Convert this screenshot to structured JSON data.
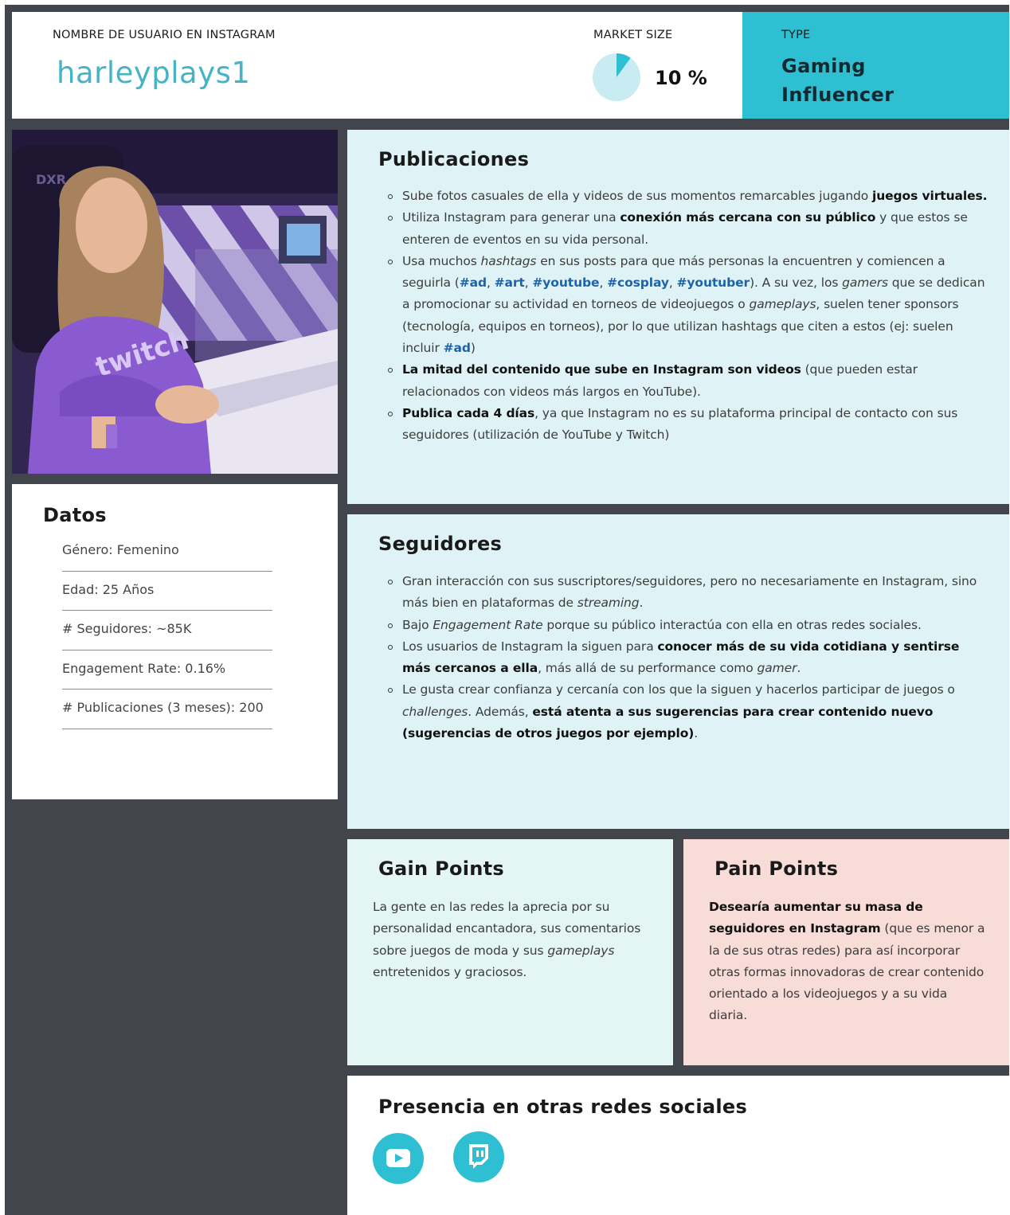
{
  "header": {
    "username_label": "NOMBRE DE USUARIO EN INSTAGRAM",
    "username": "harleyplays1",
    "market_size_label": "MARKET SIZE",
    "market_size_value": "10 %",
    "market_size_fraction": 0.1,
    "type_label": "TYPE",
    "type_line1": "Gaming",
    "type_line2": "Influencer"
  },
  "colors": {
    "background": "#42464c",
    "accent_teal": "#2ebfd3",
    "username_color": "#45b4c4",
    "publicaciones_bg": "#dff3f6",
    "gain_bg": "#e3f6f3",
    "pain_bg": "#f8dcd8",
    "hashtag_color": "#1e63a8"
  },
  "photo": {
    "icon": "profile-photo"
  },
  "datos": {
    "title": "Datos",
    "rows": [
      "Género: Femenino",
      "Edad: 25 Años",
      "# Seguidores: ~85K",
      "Engagement Rate: 0.16%",
      "# Publicaciones (3 meses): 200"
    ]
  },
  "publicaciones": {
    "title": "Publicaciones",
    "b1": {
      "t1": "Sube fotos casuales de ella y videos de sus momentos remarcables jugando ",
      "bold1": "juegos virtuales."
    },
    "b2": {
      "t1": "Utiliza Instagram para generar una ",
      "bold1": "conexión más cercana con su público",
      "t2": " y que estos se enteren de eventos en su vida personal."
    },
    "b3": {
      "t1": "Usa muchos ",
      "em1": "hashtags",
      "t2": " en sus posts para que más personas la encuentren y comiencen a seguirla (",
      "h1": "#ad",
      "sep1": ", ",
      "h2": "#art",
      "sep2": ", ",
      "h3": "#youtube",
      "sep3": ", ",
      "h4": "#cosplay",
      "sep4": ", ",
      "h5": "#youtuber",
      "t3": "). A su vez, los ",
      "em2": "gamers",
      "t4": " que se dedican a promocionar su actividad en torneos de videojuegos o ",
      "em3": "gameplays",
      "t5": ", suelen tener sponsors (tecnología, equipos en torneos), por lo que utilizan hashtags que citen a estos (ej: suelen incluir ",
      "h6": "#ad",
      "t6": ")"
    },
    "b4": {
      "bold1": "La mitad del contenido que sube en Instagram son videos",
      "t1": " (que pueden estar relacionados con videos más largos en YouTube)."
    },
    "b5": {
      "bold1": "Publica cada 4 días",
      "t1": ", ya que Instagram no es su plataforma principal de contacto con sus seguidores (utilización de YouTube y Twitch)"
    }
  },
  "seguidores": {
    "title": "Seguidores",
    "b1": {
      "t1": "Gran interacción con sus suscriptores/seguidores, pero no necesariamente en Instagram, sino más bien en plataformas de ",
      "em1": "streaming",
      "t2": "."
    },
    "b2": {
      "t1": "Bajo ",
      "em1": "Engagement Rate",
      "t2": " porque su público interactúa con ella en otras redes sociales."
    },
    "b3": {
      "t1": "Los usuarios de Instagram la siguen para ",
      "bold1": "conocer más de su vida cotidiana y sentirse más cercanos a ella",
      "t2": ", más allá de su performance como ",
      "em1": "gamer",
      "t3": "."
    },
    "b4": {
      "t1": "Le gusta crear confianza y cercanía con los que la siguen y hacerlos participar de juegos o ",
      "em1": "challenges",
      "t2": ". Además, ",
      "bold1": "está atenta a sus sugerencias para crear contenido nuevo (sugerencias de otros juegos por ejemplo)",
      "t3": "."
    }
  },
  "gain": {
    "title": "Gain Points",
    "t1": "La gente en las redes la aprecia por su personalidad encantadora, sus comentarios sobre juegos de moda y sus ",
    "em1": "gameplays",
    "t2": " entretenidos y graciosos."
  },
  "pain": {
    "title": "Pain Points",
    "bold1": "Desearía aumentar su masa de seguidores en Instagram",
    "t1": " (que es menor a la de sus otras redes) para así incorporar otras formas innovadoras de crear contenido orientado a los videojuegos y a su vida diaria."
  },
  "redes": {
    "title": "Presencia en otras redes sociales",
    "icons": [
      "youtube-icon",
      "twitch-icon"
    ]
  }
}
